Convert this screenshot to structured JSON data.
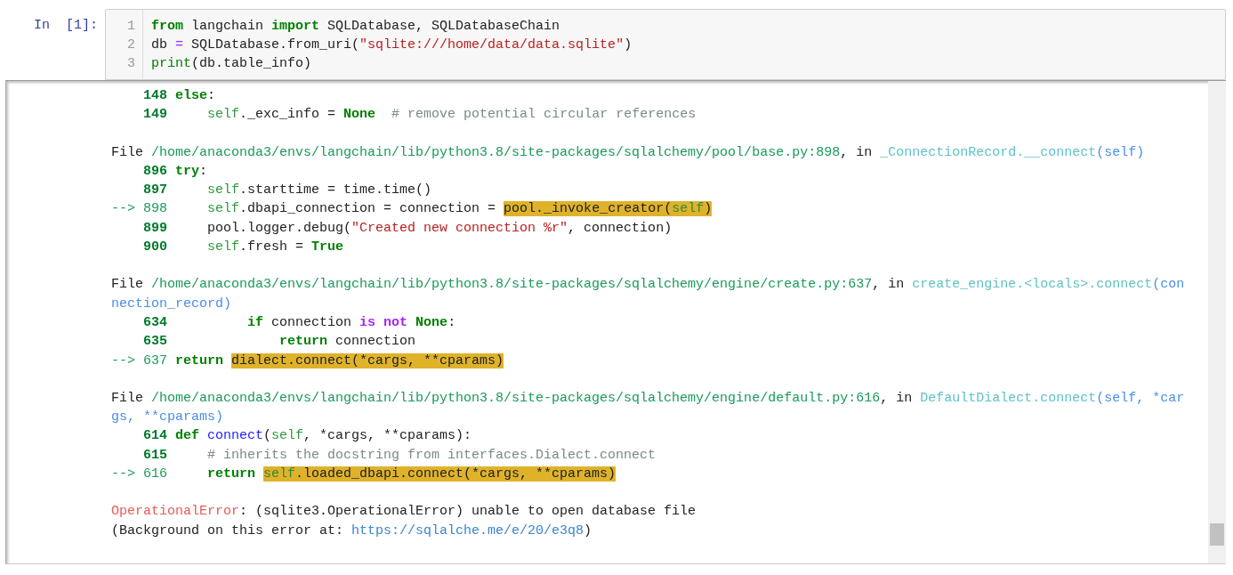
{
  "input_cell": {
    "prompt": "In  [1]:",
    "lines": [
      {
        "number": "1",
        "tokens": [
          {
            "text": "from",
            "kind": "kw"
          },
          {
            "text": " langchain ",
            "kind": "plain"
          },
          {
            "text": "import",
            "kind": "kw"
          },
          {
            "text": " SQLDatabase, SQLDatabaseChain",
            "kind": "plain"
          }
        ]
      },
      {
        "number": "2",
        "tokens": [
          {
            "text": "db ",
            "kind": "plain"
          },
          {
            "text": "=",
            "kind": "op"
          },
          {
            "text": " SQLDatabase.from_uri(",
            "kind": "plain"
          },
          {
            "text": "\"sqlite:///home/data/data.sqlite\"",
            "kind": "str"
          },
          {
            "text": ")",
            "kind": "plain"
          }
        ]
      },
      {
        "number": "3",
        "tokens": [
          {
            "text": "print",
            "kind": "builtin"
          },
          {
            "text": "(db.table_info)",
            "kind": "plain"
          }
        ]
      }
    ]
  },
  "output": {
    "blocks": [
      {
        "lines": [
          [
            {
              "text": "    148 ",
              "kind": "lineno"
            },
            {
              "text": "else",
              "kind": "kw"
            },
            {
              "text": ":",
              "kind": "plain"
            }
          ],
          [
            {
              "text": "    149     ",
              "kind": "lineno"
            },
            {
              "text": "self",
              "kind": "self"
            },
            {
              "text": "._exc_info = ",
              "kind": "plain"
            },
            {
              "text": "None",
              "kind": "kw"
            },
            {
              "text": "  # remove potential circular references",
              "kind": "comment"
            }
          ]
        ]
      },
      {
        "lines": [
          [
            {
              "text": "File ",
              "kind": "plain"
            },
            {
              "text": "/home/anaconda3/envs/langchain/lib/python3.8/site-packages/sqlalchemy/pool/base.py:898",
              "kind": "path"
            },
            {
              "text": ", in ",
              "kind": "plain"
            },
            {
              "text": "_ConnectionRecord.__connect",
              "kind": "func"
            },
            {
              "text": "(self)",
              "kind": "param"
            }
          ],
          [
            {
              "text": "    896 ",
              "kind": "lineno"
            },
            {
              "text": "try",
              "kind": "kw"
            },
            {
              "text": ":",
              "kind": "plain"
            }
          ],
          [
            {
              "text": "    897     ",
              "kind": "lineno"
            },
            {
              "text": "self",
              "kind": "self"
            },
            {
              "text": ".starttime = time.time()",
              "kind": "plain"
            }
          ],
          [
            {
              "text": "--> 898     ",
              "kind": "arrow"
            },
            {
              "text": "self",
              "kind": "self"
            },
            {
              "text": ".dbapi_connection = connection = ",
              "kind": "plain"
            },
            {
              "text": "pool._invoke_creator(",
              "kind": "hl"
            },
            {
              "text": "self",
              "kind": "hlself"
            },
            {
              "text": ")",
              "kind": "hl"
            }
          ],
          [
            {
              "text": "    899     ",
              "kind": "lineno"
            },
            {
              "text": "pool.logger.debug(",
              "kind": "plain"
            },
            {
              "text": "\"Created new connection %r\"",
              "kind": "str"
            },
            {
              "text": ", connection)",
              "kind": "plain"
            }
          ],
          [
            {
              "text": "    900     ",
              "kind": "lineno"
            },
            {
              "text": "self",
              "kind": "self"
            },
            {
              "text": ".fresh = ",
              "kind": "plain"
            },
            {
              "text": "True",
              "kind": "kw"
            }
          ]
        ]
      },
      {
        "lines": [
          [
            {
              "text": "File ",
              "kind": "plain"
            },
            {
              "text": "/home/anaconda3/envs/langchain/lib/python3.8/site-packages/sqlalchemy/engine/create.py:637",
              "kind": "path"
            },
            {
              "text": ", in ",
              "kind": "plain"
            },
            {
              "text": "create_engine.<locals>.connect",
              "kind": "func"
            },
            {
              "text": "(connection_record)",
              "kind": "param"
            }
          ],
          [
            {
              "text": "    634          ",
              "kind": "lineno"
            },
            {
              "text": "if",
              "kind": "kw"
            },
            {
              "text": " connection ",
              "kind": "plain"
            },
            {
              "text": "is not ",
              "kind": "opword"
            },
            {
              "text": "None",
              "kind": "kw"
            },
            {
              "text": ":",
              "kind": "plain"
            }
          ],
          [
            {
              "text": "    635              ",
              "kind": "lineno"
            },
            {
              "text": "return",
              "kind": "kw"
            },
            {
              "text": " connection",
              "kind": "plain"
            }
          ],
          [
            {
              "text": "--> 637 ",
              "kind": "arrow"
            },
            {
              "text": "return ",
              "kind": "kw"
            },
            {
              "text": "dialect.connect(*cargs, **cparams)",
              "kind": "hl"
            }
          ]
        ]
      },
      {
        "lines": [
          [
            {
              "text": "File ",
              "kind": "plain"
            },
            {
              "text": "/home/anaconda3/envs/langchain/lib/python3.8/site-packages/sqlalchemy/engine/default.py:616",
              "kind": "path"
            },
            {
              "text": ", in ",
              "kind": "plain"
            },
            {
              "text": "DefaultDialect.connect",
              "kind": "func"
            },
            {
              "text": "(self, *cargs, **cparams)",
              "kind": "param"
            }
          ],
          [
            {
              "text": "    614 ",
              "kind": "lineno"
            },
            {
              "text": "def ",
              "kind": "kw"
            },
            {
              "text": "connect",
              "kind": "defname"
            },
            {
              "text": "(",
              "kind": "plain"
            },
            {
              "text": "self",
              "kind": "self"
            },
            {
              "text": ", *cargs, **cparams):",
              "kind": "plain"
            }
          ],
          [
            {
              "text": "    615     ",
              "kind": "lineno"
            },
            {
              "text": "# inherits the docstring from interfaces.Dialect.connect",
              "kind": "comment"
            }
          ],
          [
            {
              "text": "--> 616     ",
              "kind": "arrow"
            },
            {
              "text": "return ",
              "kind": "kw"
            },
            {
              "text": "self",
              "kind": "hlself"
            },
            {
              "text": ".loaded_dbapi.connect(*cargs, **cparams)",
              "kind": "hl"
            }
          ]
        ]
      },
      {
        "lines": [
          [
            {
              "text": "OperationalError",
              "kind": "err"
            },
            {
              "text": ": (sqlite3.OperationalError) unable to open database file",
              "kind": "plain"
            }
          ],
          [
            {
              "text": "(Background on this error at: ",
              "kind": "plain"
            },
            {
              "text": "https://sqlalche.me/e/20/e3q8",
              "kind": "link"
            },
            {
              "text": ")",
              "kind": "plain"
            }
          ]
        ]
      }
    ]
  }
}
